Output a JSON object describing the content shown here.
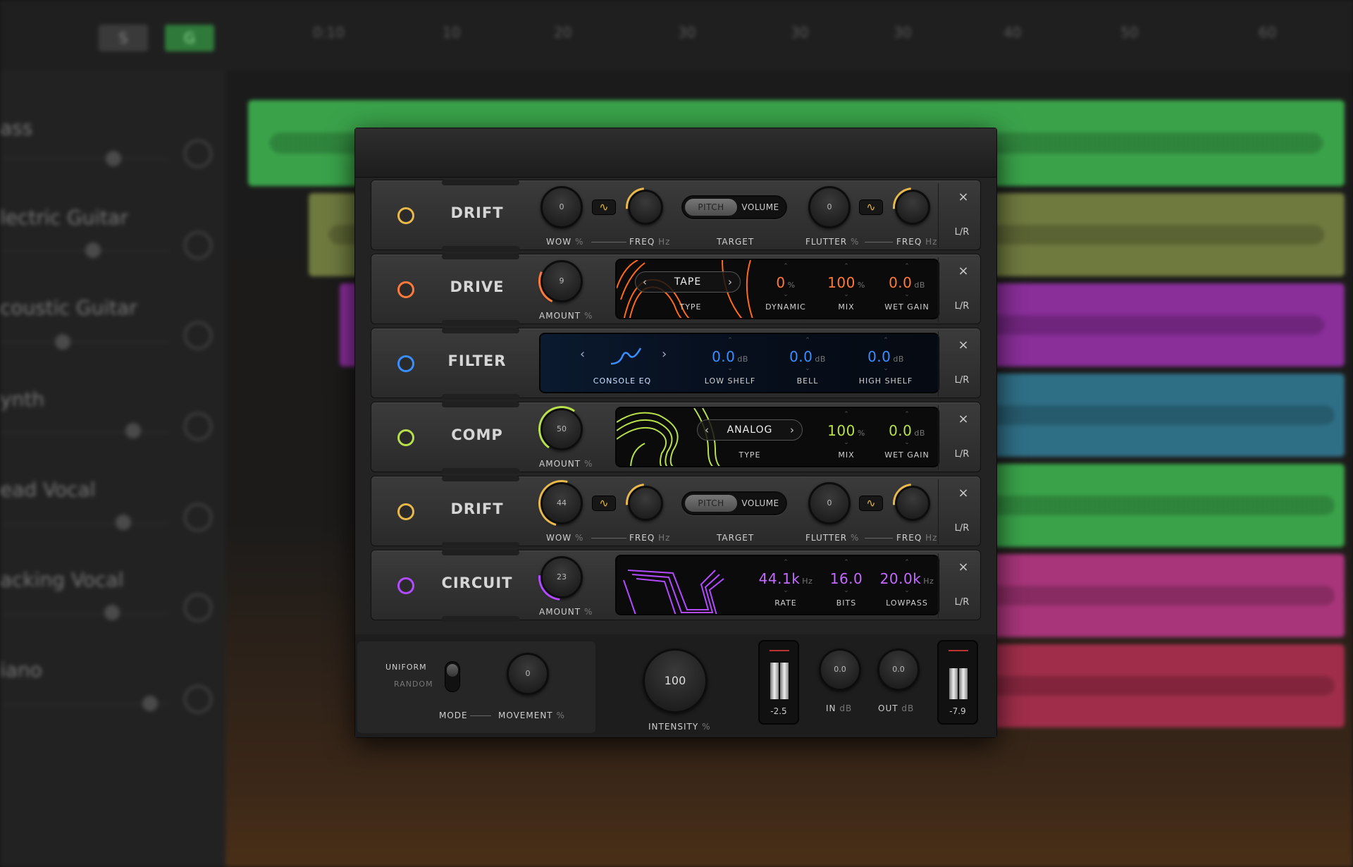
{
  "daw": {
    "timeline": [
      "0:10",
      "10",
      "20",
      "30",
      "30",
      "30",
      "40",
      "50",
      "60"
    ],
    "buttons": [
      "S",
      "G"
    ],
    "tracks": [
      "ass",
      "lectric Guitar",
      "coustic Guitar",
      "ynth",
      "ead Vocal",
      "acking Vocal",
      "iano"
    ],
    "colors": {
      "green": "#3aa34a",
      "olive": "#6f7a3f",
      "purple": "#8a2e9a",
      "teal": "#2f6f86",
      "pink": "#a8357a",
      "red": "#a02e4a"
    }
  },
  "plugin": {
    "modules": [
      {
        "name": "DRIFT",
        "led": "#e8b84a",
        "wow": "0",
        "freq_label": "FREQ",
        "freq_unit": "Hz",
        "wow_label": "WOW",
        "wow_unit": "%",
        "target": "TARGET",
        "pitch": "PITCH",
        "volume": "VOLUME",
        "flutter": "0",
        "flutter_label": "FLUTTER",
        "flutter_unit": "%",
        "freq2_label": "FREQ",
        "freq2_unit": "Hz",
        "close": "×",
        "lr": "L/R"
      },
      {
        "name": "DRIVE",
        "led": "#ff7a3a",
        "amount": "9",
        "amount_label": "AMOUNT",
        "amount_unit": "%",
        "type": "TAPE",
        "type_label": "TYPE",
        "dynamic": "0",
        "dynamic_unit": "%",
        "dynamic_label": "DYNAMIC",
        "mix": "100",
        "mix_unit": "%",
        "mix_label": "MIX",
        "wet": "0.0",
        "wet_unit": "dB",
        "wet_label": "WET GAIN",
        "close": "×",
        "lr": "L/R"
      },
      {
        "name": "FILTER",
        "led": "#3a8eff",
        "eq": "CONSOLE EQ",
        "low": "0.0",
        "low_unit": "dB",
        "low_label": "LOW SHELF",
        "bell": "0.0",
        "bell_unit": "dB",
        "bell_label": "BELL",
        "high": "0.0",
        "high_unit": "dB",
        "high_label": "HIGH SHELF",
        "close": "×",
        "lr": "L/R"
      },
      {
        "name": "COMP",
        "led": "#b8e04a",
        "amount": "50",
        "amount_label": "AMOUNT",
        "amount_unit": "%",
        "type": "ANALOG",
        "type_label": "TYPE",
        "mix": "100",
        "mix_unit": "%",
        "mix_label": "MIX",
        "wet": "0.0",
        "wet_unit": "dB",
        "wet_label": "WET GAIN",
        "close": "×",
        "lr": "L/R"
      },
      {
        "name": "DRIFT",
        "led": "#e8b84a",
        "wow": "44",
        "freq_label": "FREQ",
        "freq_unit": "Hz",
        "wow_label": "WOW",
        "wow_unit": "%",
        "target": "TARGET",
        "pitch": "PITCH",
        "volume": "VOLUME",
        "flutter": "0",
        "flutter_label": "FLUTTER",
        "flutter_unit": "%",
        "freq2_label": "FREQ",
        "freq2_unit": "Hz",
        "close": "×",
        "lr": "L/R"
      },
      {
        "name": "CIRCUIT",
        "led": "#b34aff",
        "amount": "23",
        "amount_label": "AMOUNT",
        "amount_unit": "%",
        "rate": "44.1k",
        "rate_unit": "Hz",
        "rate_label": "RATE",
        "bits": "16.0",
        "bits_label": "BITS",
        "lowpass": "20.0k",
        "lowpass_unit": "Hz",
        "lowpass_label": "LOWPASS",
        "close": "×",
        "lr": "L/R"
      }
    ],
    "bottom": {
      "uniform": "UNIFORM",
      "random": "RANDOM",
      "mode": "MODE",
      "movement": "0",
      "movement_label": "MOVEMENT",
      "movement_unit": "%",
      "intensity": "100",
      "intensity_label": "INTENSITY",
      "intensity_unit": "%",
      "in_meter": "-2.5",
      "in": "0.0",
      "in_label": "IN",
      "in_unit": "dB",
      "out": "0.0",
      "out_label": "OUT",
      "out_unit": "dB",
      "out_meter": "-7.9"
    }
  }
}
